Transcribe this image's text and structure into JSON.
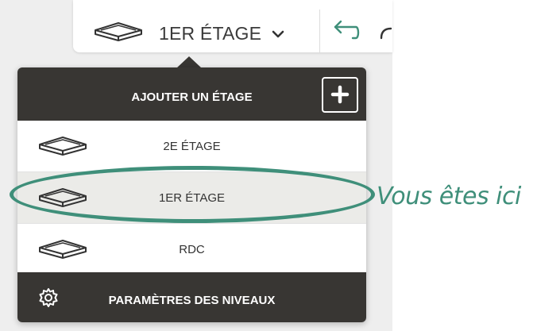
{
  "toolbar": {
    "current_floor_label": "1ER ÉTAGE",
    "current_floor_icon": "floor-box-icon",
    "dropdown_icon": "chevron-down-icon",
    "undo_icon": "undo-arrow-icon",
    "redo_icon": "redo-arrow-icon"
  },
  "dropdown": {
    "header_label": "AJOUTER UN ÉTAGE",
    "add_icon": "plus-icon",
    "floors": [
      {
        "label": "2E ÉTAGE",
        "icon": "floor-box-icon",
        "selected": false
      },
      {
        "label": "1ER ÉTAGE",
        "icon": "floor-box-icon",
        "selected": true
      },
      {
        "label": "RDC",
        "icon": "floor-box-icon",
        "selected": false
      }
    ],
    "footer_label": "PARAMÈTRES DES NIVEAUX",
    "footer_icon": "gear-icon"
  },
  "annotation": {
    "text": "Vous êtes ici",
    "color": "#3f8f7a"
  },
  "colors": {
    "dark_panel": "#383633",
    "selected_row": "#ebebe8",
    "accent_green": "#3f8f7a"
  }
}
